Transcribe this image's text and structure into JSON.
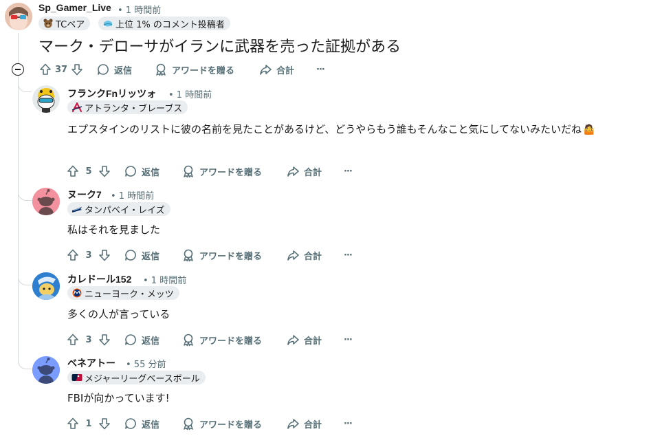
{
  "labels": {
    "reply": "返信",
    "award": "アワードを贈る",
    "share": "合計",
    "more": "···"
  },
  "top_comment": {
    "author": "Sp_Gamer_Live",
    "time": "• 1 時間前",
    "flair_1": "TCベア",
    "flair_2": "上位 1% のコメント投稿者",
    "text": "マーク・デローサがイランに武器を売った証拠がある",
    "votes": "37"
  },
  "replies": [
    {
      "author": "フランクFnリッツォ",
      "time": "• 1 時間前",
      "flair": "アトランタ・ブレーブス",
      "text": "エプスタインのリストに彼の名前を見たことがあるけど、どうやらもう誰もそんなこと気にしてないみたいだね",
      "emoji": "🤷",
      "votes": "5"
    },
    {
      "author": "ヌーク7",
      "time": "• 1 時間前",
      "flair": "タンパベイ・レイズ",
      "text": "私はそれを見ました",
      "votes": "3"
    },
    {
      "author": "カレドール152",
      "time": "• 1 時間前",
      "flair": "ニューヨーク・メッツ",
      "text": "多くの人が言っている",
      "votes": "3"
    },
    {
      "author": "ベネアトー",
      "time": "• 55 分前",
      "flair": "メジャーリーグベースボール",
      "text": "FBIが向かっています!",
      "votes": "1"
    }
  ],
  "colors": {
    "text": "#1c1c1c",
    "meta": "#576f76",
    "flair_bg": "#eaedef",
    "thread": "#d7dadc"
  }
}
